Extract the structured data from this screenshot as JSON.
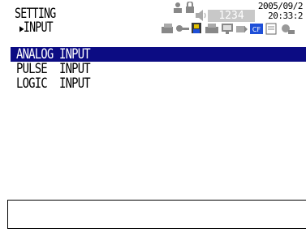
{
  "header": {
    "title": "SETTING",
    "subtitle": "INPUT",
    "counter": "1234",
    "date": "2005/09/2",
    "time": "20:33:2",
    "icons": [
      "user-icon",
      "lock-icon",
      "speaker-icon",
      "network-icon",
      "key-icon",
      "printer-icon",
      "monitor-icon",
      "card-icon",
      "cf-card-icon",
      "document-icon",
      "usb-icon"
    ]
  },
  "menu": {
    "items": [
      {
        "label": "ANALOG INPUT",
        "selected": true
      },
      {
        "label": "PULSE  INPUT",
        "selected": false
      },
      {
        "label": "LOGIC  INPUT",
        "selected": false
      }
    ]
  },
  "message_box": {
    "text": ""
  },
  "colors": {
    "selection": "#0c0c83",
    "counter_bg": "#c8c8c8",
    "cf_blue": "#1e4fd8"
  }
}
